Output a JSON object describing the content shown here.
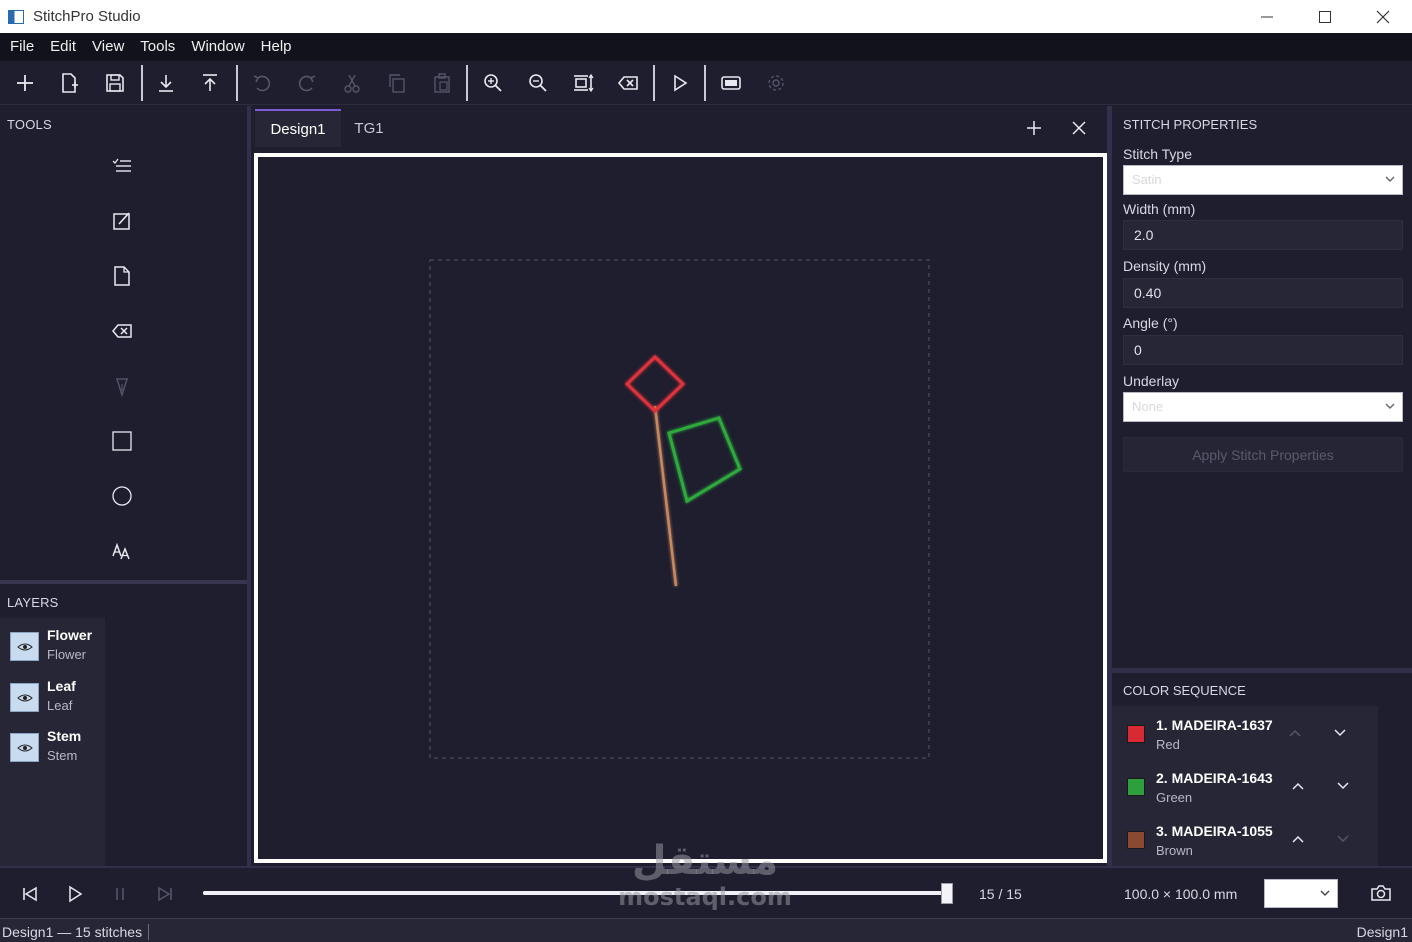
{
  "window": {
    "title": "StitchPro Studio"
  },
  "menu": [
    "File",
    "Edit",
    "View",
    "Tools",
    "Window",
    "Help"
  ],
  "toolbar": {
    "buttons": [
      "new",
      "open",
      "save",
      "import",
      "export",
      "undo",
      "redo",
      "cut",
      "copy",
      "paste",
      "zoom-in",
      "zoom-out",
      "fit",
      "delete",
      "play",
      "monitor",
      "settings"
    ]
  },
  "left_panel": {
    "tools_label": "TOOLS",
    "tools": [
      "list-tool",
      "edit-tool",
      "page-tool",
      "delete-tool",
      "pen-tool",
      "rectangle-tool",
      "circle-tool",
      "text-tool"
    ],
    "layers_label": "LAYERS",
    "layers": [
      {
        "name": "Flower",
        "sub": "Flower"
      },
      {
        "name": "Leaf",
        "sub": "Leaf"
      },
      {
        "name": "Stem",
        "sub": "Stem"
      }
    ]
  },
  "tabs": [
    {
      "label": "Design1",
      "active": true
    },
    {
      "label": "TG1",
      "active": false
    }
  ],
  "design": {
    "shapes": [
      {
        "name": "flower",
        "color": "#e0303a"
      },
      {
        "name": "leaf",
        "color": "#2eaa3c"
      },
      {
        "name": "stem",
        "color": "#c88860"
      }
    ]
  },
  "stitch_properties": {
    "label": "STITCH PROPERTIES",
    "stitch_type_label": "Stitch Type",
    "stitch_type_value": "Satin",
    "width_label": "Width (mm)",
    "width_value": "2.0",
    "density_label": "Density (mm)",
    "density_value": "0.40",
    "angle_label": "Angle (°)",
    "angle_value": "0",
    "underlay_label": "Underlay",
    "underlay_value": "None",
    "apply_label": "Apply Stitch Properties"
  },
  "color_sequence": {
    "label": "COLOR SEQUENCE",
    "items": [
      {
        "name": "1. MADEIRA-1637",
        "sub": "Red",
        "color": "#d62a34"
      },
      {
        "name": "2. MADEIRA-1643",
        "sub": "Green",
        "color": "#2e9e3e"
      },
      {
        "name": "3. MADEIRA-1055",
        "sub": "Brown",
        "color": "#8a4a32"
      }
    ]
  },
  "playback": {
    "count": "15 / 15",
    "progress": 1.0,
    "size": "100.0 × 100.0 mm"
  },
  "status": {
    "left": "Design1 — 15 stitches",
    "right": "Design1"
  },
  "watermark": {
    "arabic": "مستقل",
    "latin": "mostaql.com"
  }
}
